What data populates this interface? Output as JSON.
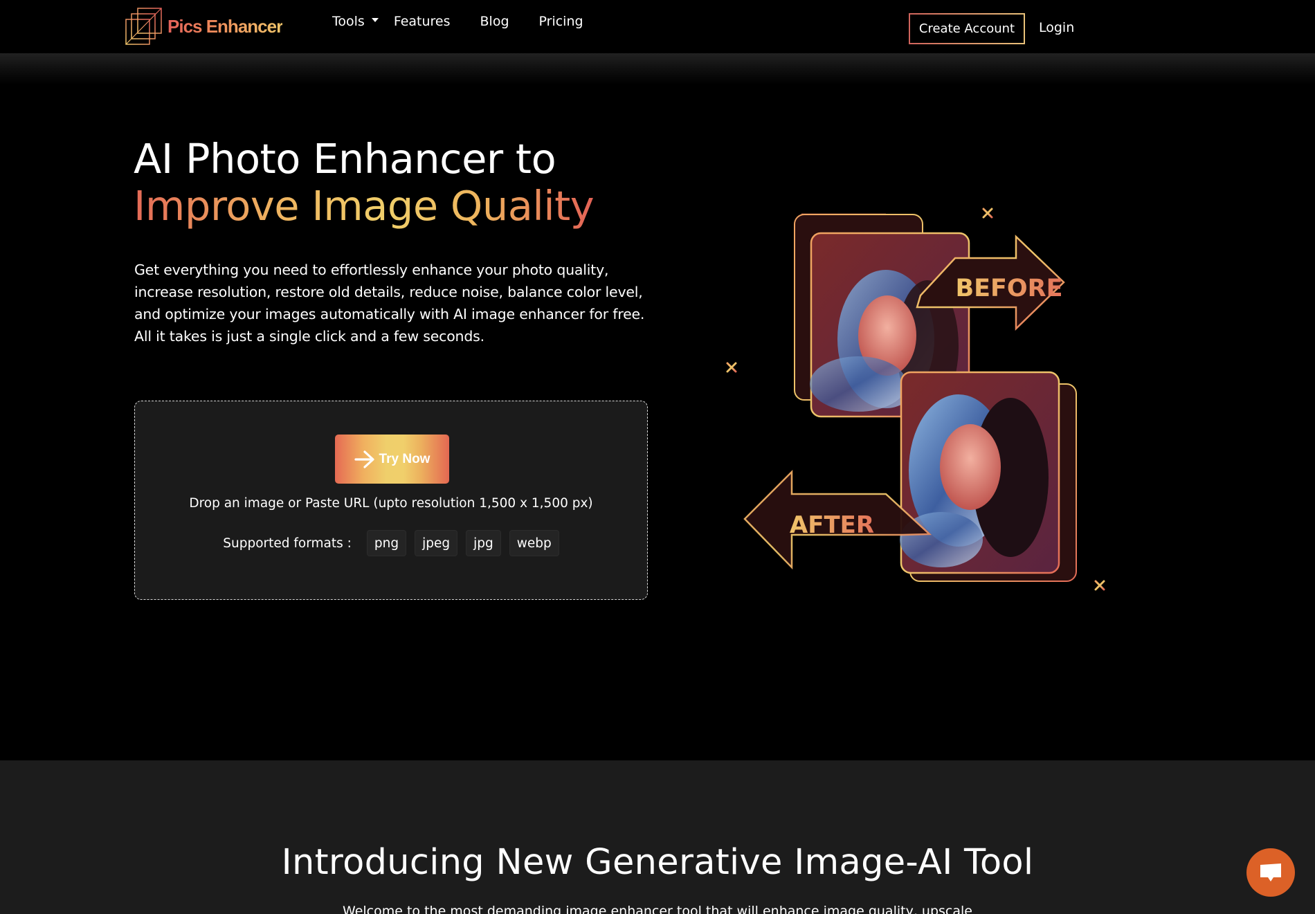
{
  "header": {
    "logo_text": "Pics Enhancer",
    "nav": [
      {
        "label": "Tools",
        "has_dropdown": true
      },
      {
        "label": "Features"
      },
      {
        "label": "Blog"
      },
      {
        "label": "Pricing"
      }
    ],
    "create_account_label": "Create Account",
    "login_label": "Login"
  },
  "hero": {
    "title_line1": "AI Photo Enhancer to",
    "title_line2": "Improve Image Quality",
    "description": "Get everything you need to effortlessly enhance your photo quality, increase resolution, restore old details, reduce noise, balance color level, and optimize your images automatically with AI image enhancer for free. All it takes is just a single click and a few seconds.",
    "upload": {
      "button_label": "Try Now",
      "button_icon": "arrow-right-icon",
      "drop_text": "Drop an image or Paste URL (upto resolution 1,500 x 1,500 px)",
      "formats_label": "Supported formats :",
      "formats": [
        "png",
        "jpeg",
        "jpg",
        "webp"
      ]
    },
    "illustration": {
      "before_label": "BEFORE",
      "after_label": "AFTER"
    }
  },
  "section2": {
    "title": "Introducing New Generative Image-AI Tool",
    "subtitle": "Welcome to the most demanding image enhancer tool that will enhance image quality, upscale"
  },
  "chat": {
    "icon": "chat-bubble-icon"
  },
  "colors": {
    "accent_red": "#e4615a",
    "accent_yellow": "#f0cf6a",
    "chat_orange": "#dc6127",
    "section2_bg": "#1c1c1c",
    "dropzone_bg": "#1b1b1b"
  }
}
